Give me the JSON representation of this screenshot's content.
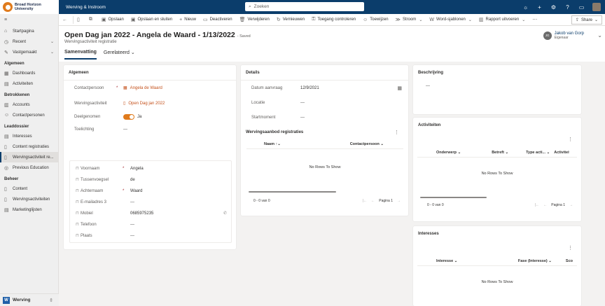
{
  "topbar": {
    "logo_line1": "Broad Horizon",
    "logo_line2": "University",
    "app_name": "Werving & Instroom",
    "search_placeholder": "Zoeken",
    "icons": [
      "lightbulb-icon",
      "plus-icon",
      "gear-icon",
      "help-icon",
      "chat-icon",
      "user-avatar"
    ]
  },
  "sidebar": {
    "top_items": [
      {
        "label": "Startpagina",
        "icon": "home-icon"
      },
      {
        "label": "Recent",
        "icon": "clock-icon"
      },
      {
        "label": "Vastgemaakt",
        "icon": "pin-icon"
      }
    ],
    "groups": [
      {
        "title": "Algemeen",
        "items": [
          {
            "label": "Dashboards",
            "icon": "dashboard-icon"
          },
          {
            "label": "Activiteiten",
            "icon": "activity-icon"
          }
        ]
      },
      {
        "title": "Betrokkenen",
        "items": [
          {
            "label": "Accounts",
            "icon": "building-icon"
          },
          {
            "label": "Contactpersonen",
            "icon": "person-icon"
          }
        ]
      },
      {
        "title": "Leaddossier",
        "items": [
          {
            "label": "Interesses",
            "icon": "list-icon"
          },
          {
            "label": "Content registraties",
            "icon": "doc-icon"
          },
          {
            "label": "Wervingsactiviteit re...",
            "icon": "doc-icon",
            "active": true
          },
          {
            "label": "Previous Education",
            "icon": "globe-icon"
          }
        ]
      },
      {
        "title": "Beheer",
        "items": [
          {
            "label": "Content",
            "icon": "doc-icon"
          },
          {
            "label": "Wervingsactiviteiten",
            "icon": "doc-icon"
          },
          {
            "label": "Marketinglijsten",
            "icon": "list-icon"
          }
        ]
      }
    ],
    "area_badge": "W",
    "area_label": "Werving"
  },
  "commands": [
    {
      "label": "",
      "icon": "back-icon"
    },
    {
      "label": "",
      "icon": "form-icon"
    },
    {
      "label": "",
      "icon": "popout-icon"
    },
    {
      "label": "Opslaan",
      "icon": "save-icon"
    },
    {
      "label": "Opslaan en sluiten",
      "icon": "save-close-icon"
    },
    {
      "label": "Nieuw",
      "icon": "plus-icon"
    },
    {
      "label": "Deactiveren",
      "icon": "deactivate-icon"
    },
    {
      "label": "Verwijderen",
      "icon": "trash-icon"
    },
    {
      "label": "Vernieuwen",
      "icon": "refresh-icon"
    },
    {
      "label": "Toegang controleren",
      "icon": "access-icon"
    },
    {
      "label": "Toewijzen",
      "icon": "assign-icon"
    },
    {
      "label": "Stroom",
      "icon": "flow-icon",
      "dropdown": true
    },
    {
      "label": "Word-sjablonen",
      "icon": "word-icon",
      "dropdown": true
    },
    {
      "label": "Rapport uitvoeren",
      "icon": "report-icon",
      "dropdown": true
    }
  ],
  "share_label": "Share",
  "header": {
    "title": "Open Dag jan 2022 - Angela de Waard - 1/13/2022",
    "saved": "- Saved",
    "entity": "Wervingsactiviteit registratie",
    "owner_initials": "JG",
    "owner_name": "Jakob van Gorp",
    "owner_role": "Eigenaar",
    "tabs": [
      {
        "label": "Samenvatting",
        "active": true
      },
      {
        "label": "Gerelateerd",
        "dropdown": true
      }
    ]
  },
  "algemeen": {
    "title": "Algemeen",
    "contactpersoon_label": "Contactpersoon",
    "contactpersoon_value": "Angela de Waard",
    "wervingsactiviteit_label": "Wervingsactiviteit",
    "wervingsactiviteit_value": "Open Dag jan 2022",
    "deelgenomen_label": "Deelgenomen",
    "deelgenomen_value": "Ja",
    "toelichting_label": "Toelichting",
    "toelichting_value": "---",
    "quick": [
      {
        "label": "Voornaam",
        "value": "Angela",
        "req": "*"
      },
      {
        "label": "Tussenvoegsel",
        "value": "de",
        "req": ""
      },
      {
        "label": "Achternaam",
        "value": "Waard",
        "req": "*"
      },
      {
        "label": "E-mailadres 3",
        "value": "---",
        "req": ""
      },
      {
        "label": "Mobiel",
        "value": "0685975235",
        "req": "",
        "phone": true
      },
      {
        "label": "Telefoon",
        "value": "---",
        "req": ""
      },
      {
        "label": "Plaats",
        "value": "---",
        "req": ""
      }
    ]
  },
  "details": {
    "title": "Details",
    "datum_label": "Datum aanvraag",
    "datum_value": "12/9/2021",
    "locatie_label": "Locatie",
    "locatie_value": "---",
    "startmoment_label": "Startmoment",
    "startmoment_value": "---",
    "subgrid_title": "Wervingsaanbod registraties",
    "col1": "Naam",
    "col2": "Contactpersoon",
    "norows": "No Rows To Show",
    "count": "0 - 0 van 0",
    "page": "Pagina 1"
  },
  "beschrijving": {
    "title": "Beschrijving",
    "value": "---"
  },
  "activiteiten": {
    "title": "Activiteiten",
    "cols": [
      "Onderwerp",
      "Betreft",
      "Type acti...",
      "Activiteitsstatu"
    ],
    "norows": "No Rows To Show",
    "count": "0 - 0 van 0",
    "page": "Pagina 1"
  },
  "interesses": {
    "title": "Interesses",
    "cols": [
      "Interesse",
      "Fase (Interesse)",
      "Sco"
    ],
    "norows": "No Rows To Show"
  },
  "colors": {
    "nav": "#0b3d6b",
    "accent": "#e07b1d",
    "link": "#c4501a"
  }
}
